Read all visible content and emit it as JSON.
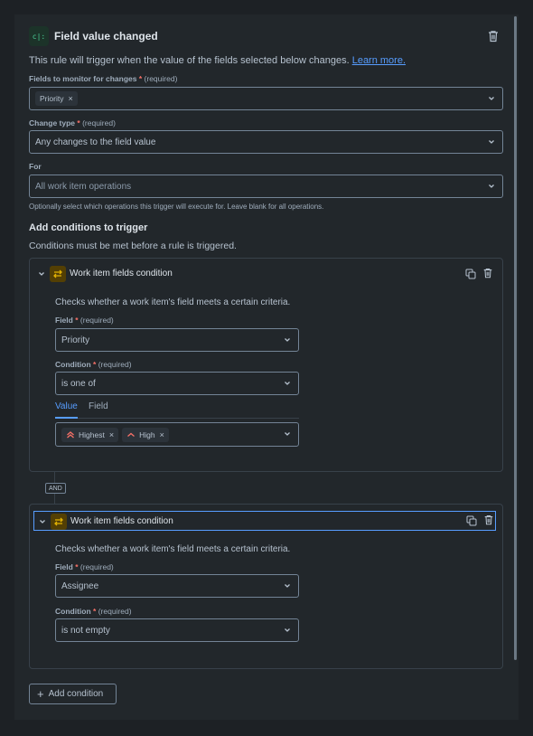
{
  "header": {
    "title": "Field value changed",
    "icon_label": "c|:"
  },
  "description": {
    "text": "This rule will trigger when the value of the fields selected below changes.",
    "link": "Learn more."
  },
  "fields_to_monitor": {
    "label": "Fields to monitor for changes",
    "required_marker": "*",
    "required_text": "(required)",
    "tags": [
      "Priority"
    ]
  },
  "change_type": {
    "label": "Change type",
    "required_marker": "*",
    "required_text": "(required)",
    "value": "Any changes to the field value"
  },
  "for_field": {
    "label": "For",
    "placeholder": "All work item operations",
    "hint": "Optionally select which operations this trigger will execute for. Leave blank for all operations."
  },
  "conditions": {
    "title": "Add conditions to trigger",
    "subtitle": "Conditions must be met before a rule is triggered.",
    "connector": "AND",
    "items": [
      {
        "title": "Work item fields condition",
        "description": "Checks whether a work item's field meets a certain criteria.",
        "field_label": "Field",
        "condition_label": "Condition",
        "required_marker": "*",
        "required_text": "(required)",
        "field_value": "Priority",
        "condition_value": "is one of",
        "tabs": [
          "Value",
          "Field"
        ],
        "active_tab": "Value",
        "values": [
          "Highest",
          "High"
        ]
      },
      {
        "title": "Work item fields condition",
        "description": "Checks whether a work item's field meets a certain criteria.",
        "field_label": "Field",
        "condition_label": "Condition",
        "required_marker": "*",
        "required_text": "(required)",
        "field_value": "Assignee",
        "condition_value": "is not empty"
      }
    ],
    "add_label": "Add condition"
  },
  "colors": {
    "accent": "#579dff",
    "required": "#f87168",
    "priority": "#f87168",
    "trigger_icon": "#4bce97",
    "condition_icon": "#e2b203"
  }
}
